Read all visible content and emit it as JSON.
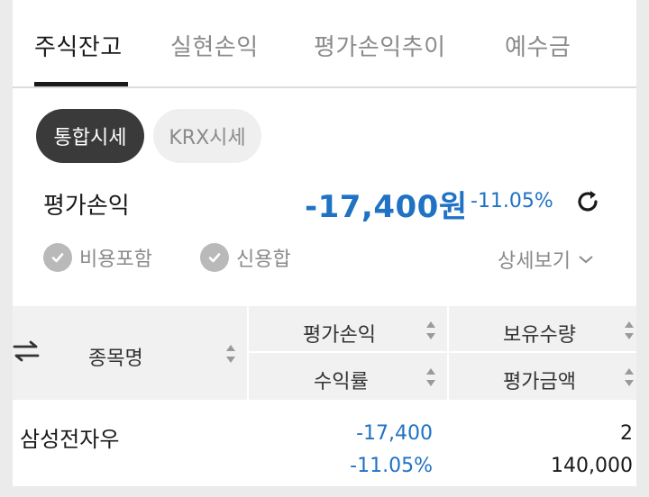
{
  "tabs": [
    {
      "label": "주식잔고",
      "active": true
    },
    {
      "label": "실현손익",
      "active": false
    },
    {
      "label": "평가손익추이",
      "active": false
    },
    {
      "label": "예수금",
      "active": false
    }
  ],
  "price_mode": {
    "options": [
      "통합시세",
      "KRX시세"
    ],
    "selected": "통합시세"
  },
  "summary": {
    "label": "평가손익",
    "amount": "-17,400원",
    "rate": "-11.05%",
    "refresh_icon": "refresh-icon"
  },
  "filters": {
    "include_fees": "비용포함",
    "credit_sum": "신용합",
    "detail_link": "상세보기"
  },
  "table": {
    "headers": {
      "name": "종목명",
      "profit": "평가손익",
      "rate": "수익률",
      "quantity": "보유수량",
      "value": "평가금액"
    },
    "rows": [
      {
        "name": "삼성전자우",
        "profit": "-17,400",
        "rate": "-11.05%",
        "quantity": "2",
        "value": "140,000"
      }
    ]
  },
  "colors": {
    "loss": "#1f72c4",
    "active_pill": "#3a3a3a",
    "header_bg": "#f1f1f1"
  }
}
